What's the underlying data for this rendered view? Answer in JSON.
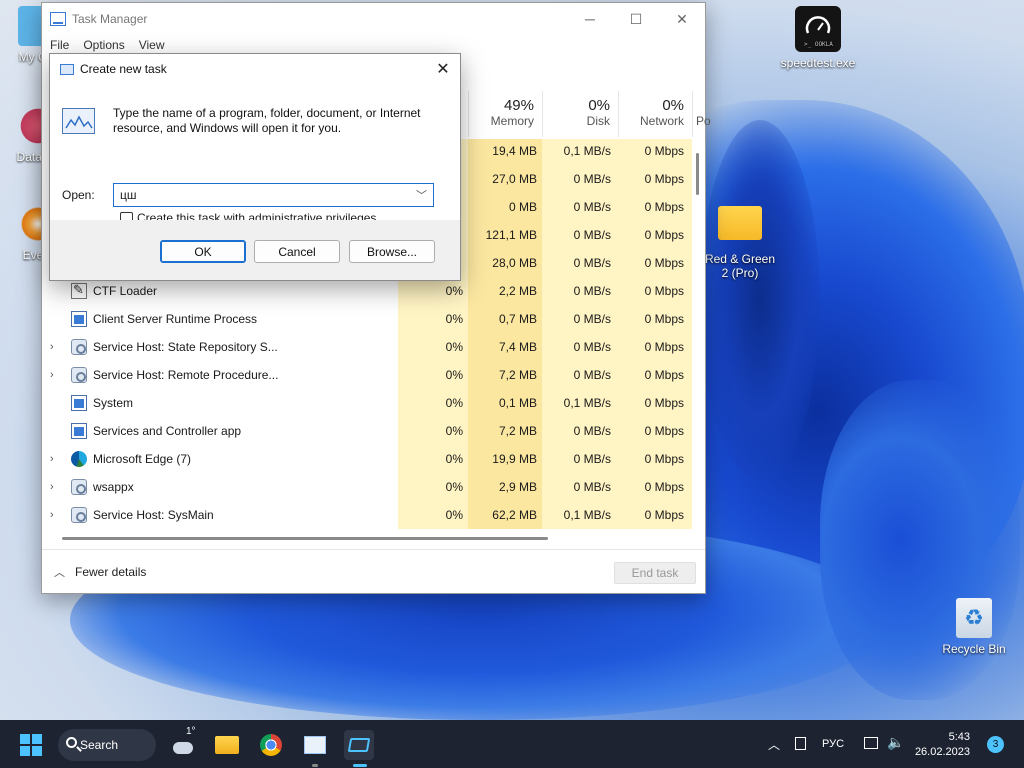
{
  "desktop": {
    "icons": [
      {
        "label": "My Cor"
      },
      {
        "label": "DataWa"
      },
      {
        "label": "Every"
      },
      {
        "label": "speedtest.exe"
      },
      {
        "label": "Red & Green 2 (Pro)"
      },
      {
        "label": "Recycle Bin"
      }
    ]
  },
  "task_manager": {
    "title": "Task Manager",
    "menu": [
      "File",
      "Options",
      "View"
    ],
    "columns": {
      "memory": {
        "pct": "49%",
        "name": "Memory"
      },
      "disk": {
        "pct": "0%",
        "name": "Disk"
      },
      "network": {
        "pct": "0%",
        "name": "Network"
      },
      "power": {
        "name": "Po"
      }
    },
    "rows": [
      {
        "name": "",
        "cpu": "",
        "memory": "19,4 MB",
        "disk": "0,1 MB/s",
        "network": "0 Mbps"
      },
      {
        "name": "",
        "cpu": "",
        "memory": "27,0 MB",
        "disk": "0 MB/s",
        "network": "0 Mbps"
      },
      {
        "name": "",
        "cpu": "",
        "memory": "0 MB",
        "disk": "0 MB/s",
        "network": "0 Mbps"
      },
      {
        "name": "",
        "cpu": "",
        "memory": "121,1 MB",
        "disk": "0 MB/s",
        "network": "0 Mbps"
      },
      {
        "name": "",
        "cpu": "",
        "memory": "28,0 MB",
        "disk": "0 MB/s",
        "network": "0 Mbps"
      },
      {
        "name": "CTF Loader",
        "cpu": "0%",
        "memory": "2,2 MB",
        "disk": "0 MB/s",
        "network": "0 Mbps",
        "icon": "ctf-icon"
      },
      {
        "name": "Client Server Runtime Process",
        "cpu": "0%",
        "memory": "0,7 MB",
        "disk": "0 MB/s",
        "network": "0 Mbps",
        "icon": "window-icon"
      },
      {
        "name": "Service Host: State Repository S...",
        "cpu": "0%",
        "memory": "7,4 MB",
        "disk": "0 MB/s",
        "network": "0 Mbps",
        "icon": "gear-icon",
        "expandable": true
      },
      {
        "name": "Service Host: Remote Procedure...",
        "cpu": "0%",
        "memory": "7,2 MB",
        "disk": "0 MB/s",
        "network": "0 Mbps",
        "icon": "gear-icon",
        "expandable": true
      },
      {
        "name": "System",
        "cpu": "0%",
        "memory": "0,1 MB",
        "disk": "0,1 MB/s",
        "network": "0 Mbps",
        "icon": "window-icon"
      },
      {
        "name": "Services and Controller app",
        "cpu": "0%",
        "memory": "7,2 MB",
        "disk": "0 MB/s",
        "network": "0 Mbps",
        "icon": "window-icon"
      },
      {
        "name": "Microsoft Edge (7)",
        "cpu": "0%",
        "memory": "19,9 MB",
        "disk": "0 MB/s",
        "network": "0 Mbps",
        "icon": "edge-icon",
        "expandable": true
      },
      {
        "name": "wsappx",
        "cpu": "0%",
        "memory": "2,9 MB",
        "disk": "0 MB/s",
        "network": "0 Mbps",
        "icon": "gear-icon",
        "expandable": true
      },
      {
        "name": "Service Host: SysMain",
        "cpu": "0%",
        "memory": "62,2 MB",
        "disk": "0,1 MB/s",
        "network": "0 Mbps",
        "icon": "gear-icon",
        "expandable": true
      }
    ],
    "footer": {
      "fewer_details": "Fewer details",
      "end_task": "End task"
    }
  },
  "dialog": {
    "title": "Create new task",
    "description": "Type the name of a program, folder, document, or Internet resource, and Windows will open it for you.",
    "open_label": "Open:",
    "open_value": "цш",
    "admin_checkbox_label": "Create this task with administrative privileges.",
    "admin_checked": false,
    "ok": "OK",
    "cancel": "Cancel",
    "browse": "Browse..."
  },
  "taskbar": {
    "search_label": "Search",
    "weather_temp": "1°",
    "language": "РУС",
    "time": "5:43",
    "date": "26.02.2023",
    "notification_count": "3"
  },
  "colors": {
    "accent": "#1a6fd0",
    "taskbar_bg": "#1d2330",
    "heat_column": "#fff4c4"
  }
}
